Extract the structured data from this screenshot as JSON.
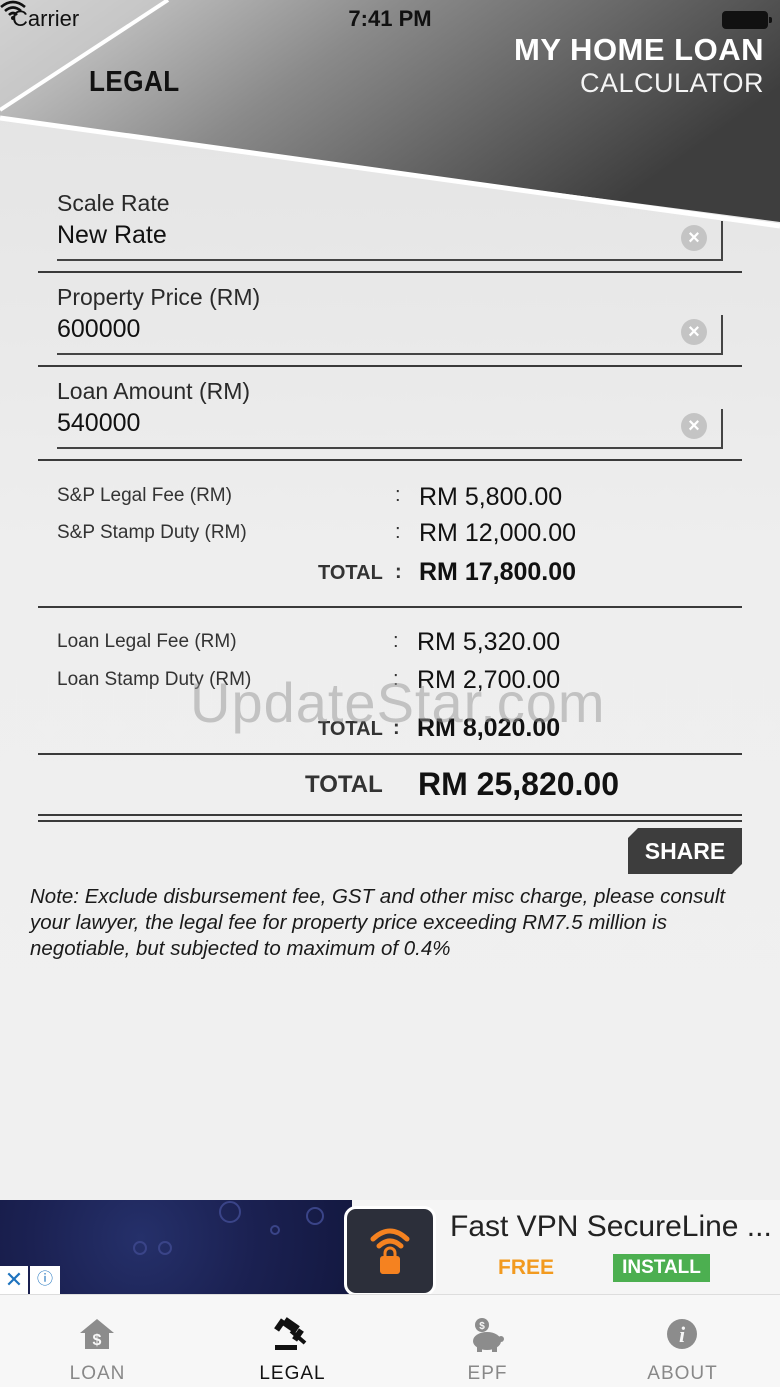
{
  "status_bar": {
    "carrier": "Carrier",
    "time": "7:41 PM"
  },
  "header": {
    "screen_title": "LEGAL",
    "brand_line1": "MY HOME LOAN",
    "brand_line2": "CALCULATOR"
  },
  "fields": {
    "scale_rate": {
      "label": "Scale Rate",
      "value": "New Rate"
    },
    "property_price": {
      "label": "Property Price (RM)",
      "value": "600000"
    },
    "loan_amount": {
      "label": "Loan Amount (RM)",
      "value": "540000"
    }
  },
  "sp": {
    "legal_fee_label": "S&P Legal Fee (RM)",
    "legal_fee_value": "RM 5,800.00",
    "stamp_duty_label": "S&P Stamp Duty (RM)",
    "stamp_duty_value": "RM 12,000.00",
    "total_label": "TOTAL",
    "total_value": "RM 17,800.00"
  },
  "loan": {
    "legal_fee_label": "Loan Legal Fee (RM)",
    "legal_fee_value": "RM 5,320.00",
    "stamp_duty_label": "Loan Stamp Duty (RM)",
    "stamp_duty_value": "RM 2,700.00",
    "total_label": "TOTAL",
    "total_value": "RM 8,020.00"
  },
  "colon": ":",
  "grand_total": {
    "label": "TOTAL",
    "value": "RM 25,820.00"
  },
  "share_label": "SHARE",
  "note": "Note: Exclude disbursement fee, GST and other misc charge, please consult your lawyer, the legal fee for property price exceeding RM7.5 million is negotiable, but subjected to maximum of 0.4%",
  "watermark": "UpdateStar.com",
  "ad": {
    "title": "Fast VPN SecureLine ...",
    "price": "FREE",
    "install_label": "INSTALL"
  },
  "tabs": [
    {
      "label": "LOAN",
      "icon": "house-dollar-icon",
      "active": false
    },
    {
      "label": "LEGAL",
      "icon": "gavel-icon",
      "active": true
    },
    {
      "label": "EPF",
      "icon": "piggy-bank-icon",
      "active": false
    },
    {
      "label": "ABOUT",
      "icon": "info-icon",
      "active": false
    }
  ],
  "colors": {
    "header_dark": "#5a5a5a",
    "tab_inactive": "#888888",
    "ad_price": "#f29a1f",
    "ad_install": "#4caf50"
  }
}
